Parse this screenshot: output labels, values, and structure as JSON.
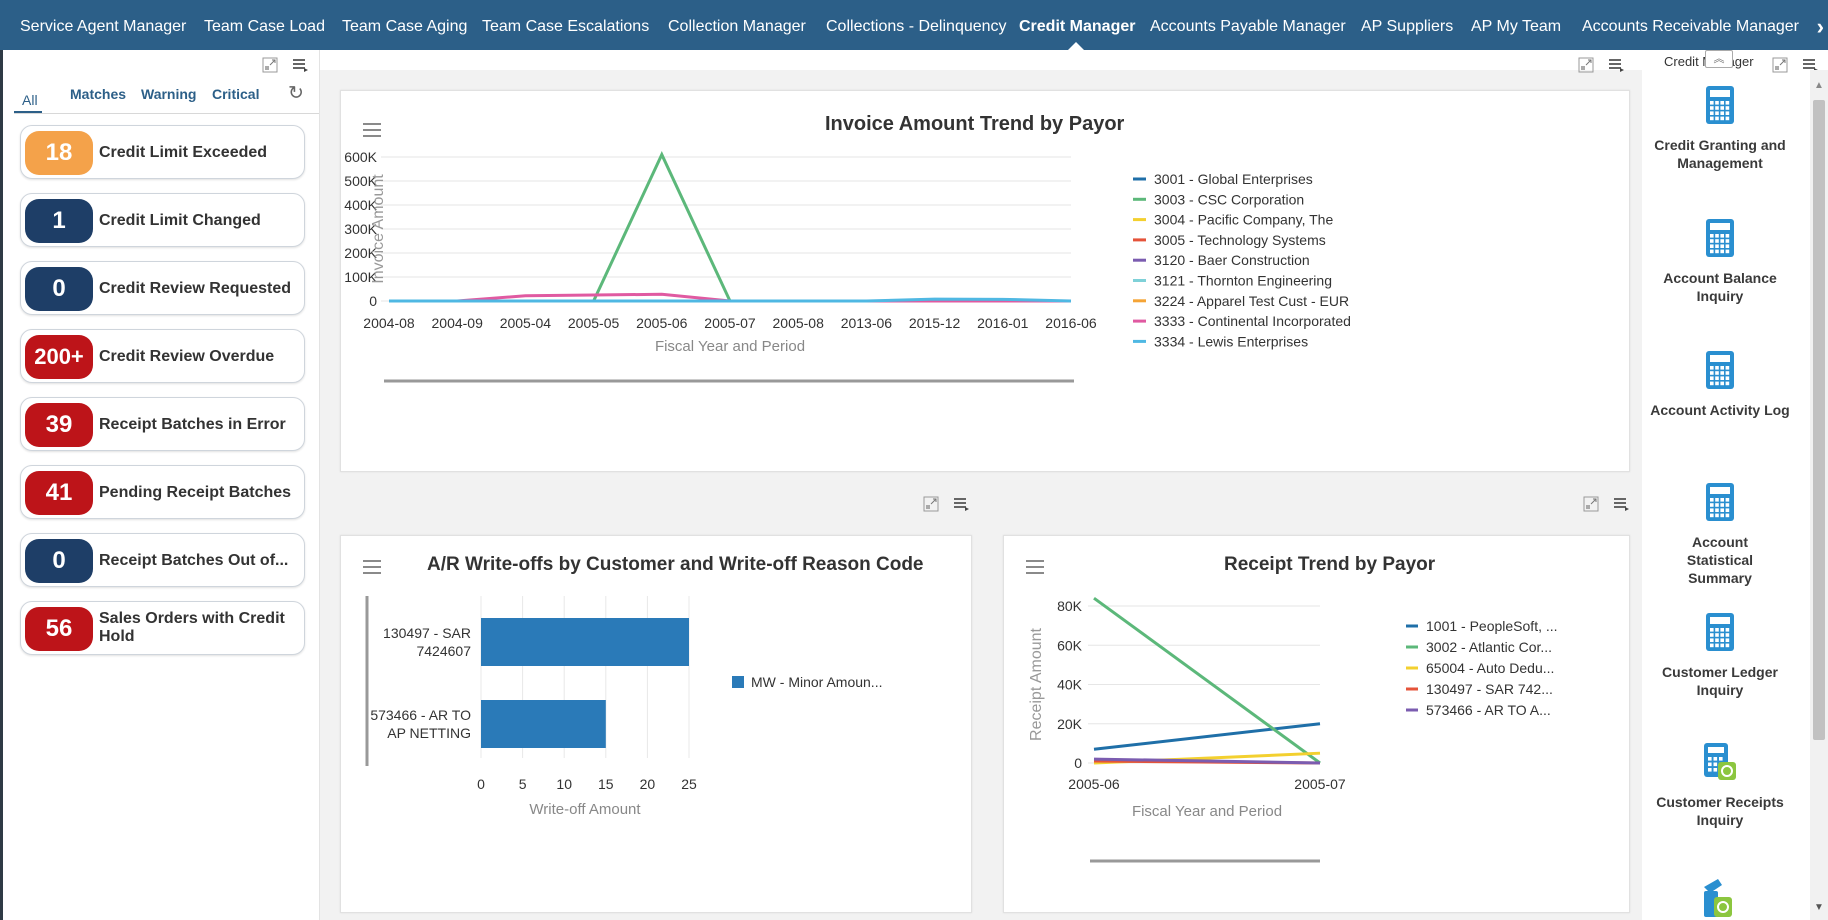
{
  "nav": {
    "tabs": [
      "Service Agent Manager",
      "Team Case Load",
      "Team Case Aging",
      "Team Case Escalations",
      "Collection Manager",
      "Collections - Delinquency",
      "Credit Manager",
      "Accounts Payable Manager",
      "AP Suppliers",
      "AP My Team",
      "Accounts Receivable Manager"
    ],
    "active": "Credit Manager",
    "more": "›"
  },
  "filters": {
    "all": "All",
    "matches": "Matches",
    "warning": "Warning",
    "critical": "Critical",
    "refresh": "↻"
  },
  "tiles": [
    {
      "count": "18",
      "label": "Credit Limit Exceeded",
      "color": "orange"
    },
    {
      "count": "1",
      "label": "Credit Limit Changed",
      "color": "blue"
    },
    {
      "count": "0",
      "label": "Credit Review Requested",
      "color": "blue"
    },
    {
      "count": "200+",
      "label": "Credit Review Overdue",
      "color": "red"
    },
    {
      "count": "39",
      "label": "Receipt Batches in Error",
      "color": "red"
    },
    {
      "count": "41",
      "label": "Pending Receipt Batches",
      "color": "red"
    },
    {
      "count": "0",
      "label": "Receipt Batches Out of...",
      "color": "blue"
    },
    {
      "count": "56",
      "label": "Sales Orders with Credit Hold",
      "color": "red"
    }
  ],
  "colors": {
    "nav_bg": "#2c5f88",
    "orange": "#f4a24a",
    "blue": "#1e3e67",
    "red": "#bd1419",
    "bar": "#2a7ab8"
  },
  "chart_data": [
    {
      "type": "line",
      "title": "Invoice Amount Trend by Payor",
      "xlabel": "Fiscal Year and Period",
      "ylabel": "Invoice Amount",
      "ylim": [
        0,
        600000
      ],
      "yticks": [
        "0",
        "100K",
        "200K",
        "300K",
        "400K",
        "500K",
        "600K"
      ],
      "x": [
        "2004-08",
        "2004-09",
        "2005-04",
        "2005-05",
        "2005-06",
        "2005-07",
        "2005-08",
        "2013-06",
        "2015-12",
        "2016-01",
        "2016-06"
      ],
      "legend_position": "right",
      "series": [
        {
          "name": "3001 - Global Enterprises",
          "color": "#1f6fa8",
          "values": [
            0,
            0,
            0,
            0,
            0,
            0,
            0,
            0,
            0,
            0,
            0
          ]
        },
        {
          "name": "3003 - CSC Corporation",
          "color": "#5cb87a",
          "values": [
            0,
            0,
            0,
            0,
            610000,
            0,
            0,
            0,
            0,
            0,
            0
          ]
        },
        {
          "name": "3004 - Pacific Company, The",
          "color": "#f3d02f",
          "values": [
            0,
            0,
            0,
            0,
            0,
            0,
            0,
            0,
            0,
            0,
            0
          ]
        },
        {
          "name": "3005 - Technology Systems",
          "color": "#e5533a",
          "values": [
            0,
            0,
            0,
            0,
            0,
            0,
            0,
            0,
            0,
            0,
            0
          ]
        },
        {
          "name": "3120 - Baer Construction",
          "color": "#7b5cb0",
          "values": [
            0,
            0,
            0,
            0,
            0,
            0,
            0,
            0,
            0,
            0,
            0
          ]
        },
        {
          "name": "3121 - Thornton Engineering",
          "color": "#7fd1d8",
          "values": [
            0,
            0,
            0,
            0,
            0,
            0,
            0,
            0,
            0,
            0,
            0
          ]
        },
        {
          "name": "3224 - Apparel Test Cust - EUR",
          "color": "#f5a436",
          "values": [
            0,
            0,
            0,
            0,
            0,
            0,
            0,
            0,
            0,
            0,
            0
          ]
        },
        {
          "name": "3333 - Continental Incorporated",
          "color": "#e05aa1",
          "values": [
            0,
            0,
            22000,
            25000,
            28000,
            0,
            0,
            0,
            0,
            0,
            0
          ]
        },
        {
          "name": "3334 - Lewis Enterprises",
          "color": "#4fb8e3",
          "values": [
            0,
            0,
            0,
            0,
            0,
            0,
            0,
            0,
            8000,
            7000,
            0
          ]
        }
      ]
    },
    {
      "type": "bar",
      "orientation": "horizontal",
      "title": "A/R Write-offs by Customer and Write-off Reason Code",
      "xlabel": "Write-off Amount",
      "ylabel": "",
      "xlim": [
        0,
        25
      ],
      "xticks": [
        "0",
        "5",
        "10",
        "15",
        "20",
        "25"
      ],
      "categories": [
        [
          "130497 - SAR",
          "7424607"
        ],
        [
          "573466 - AR TO",
          "AP NETTING"
        ]
      ],
      "legend_position": "right",
      "series": [
        {
          "name": "MW - Minor Amoun...",
          "color": "#2a7ab8",
          "values": [
            25,
            15
          ]
        }
      ]
    },
    {
      "type": "line",
      "title": "Receipt Trend by Payor",
      "xlabel": "Fiscal Year and Period",
      "ylabel": "Receipt Amount",
      "ylim": [
        0,
        80000
      ],
      "yticks": [
        "0",
        "20K",
        "40K",
        "60K",
        "80K"
      ],
      "x": [
        "2005-06",
        "2005-07"
      ],
      "legend_position": "right",
      "series": [
        {
          "name": "1001 - PeopleSoft, ...",
          "color": "#1f6fa8",
          "values": [
            7000,
            20000
          ]
        },
        {
          "name": "3002 - Atlantic Cor...",
          "color": "#5cb87a",
          "values": [
            84000,
            0
          ]
        },
        {
          "name": "65004 - Auto Dedu...",
          "color": "#f3d02f",
          "values": [
            0,
            5000
          ]
        },
        {
          "name": "130497 - SAR 742...",
          "color": "#e5533a",
          "values": [
            1000,
            0
          ]
        },
        {
          "name": "573466 - AR TO A...",
          "color": "#7b5cb0",
          "values": [
            2000,
            0
          ]
        }
      ]
    }
  ],
  "right_sidebar": {
    "header": "Credit Manager",
    "items": [
      "Credit Granting and Management",
      "Account Balance Inquiry",
      "Account Activity Log",
      "Account Statistical Summary",
      "Customer Ledger Inquiry",
      "Customer Receipts Inquiry"
    ]
  }
}
